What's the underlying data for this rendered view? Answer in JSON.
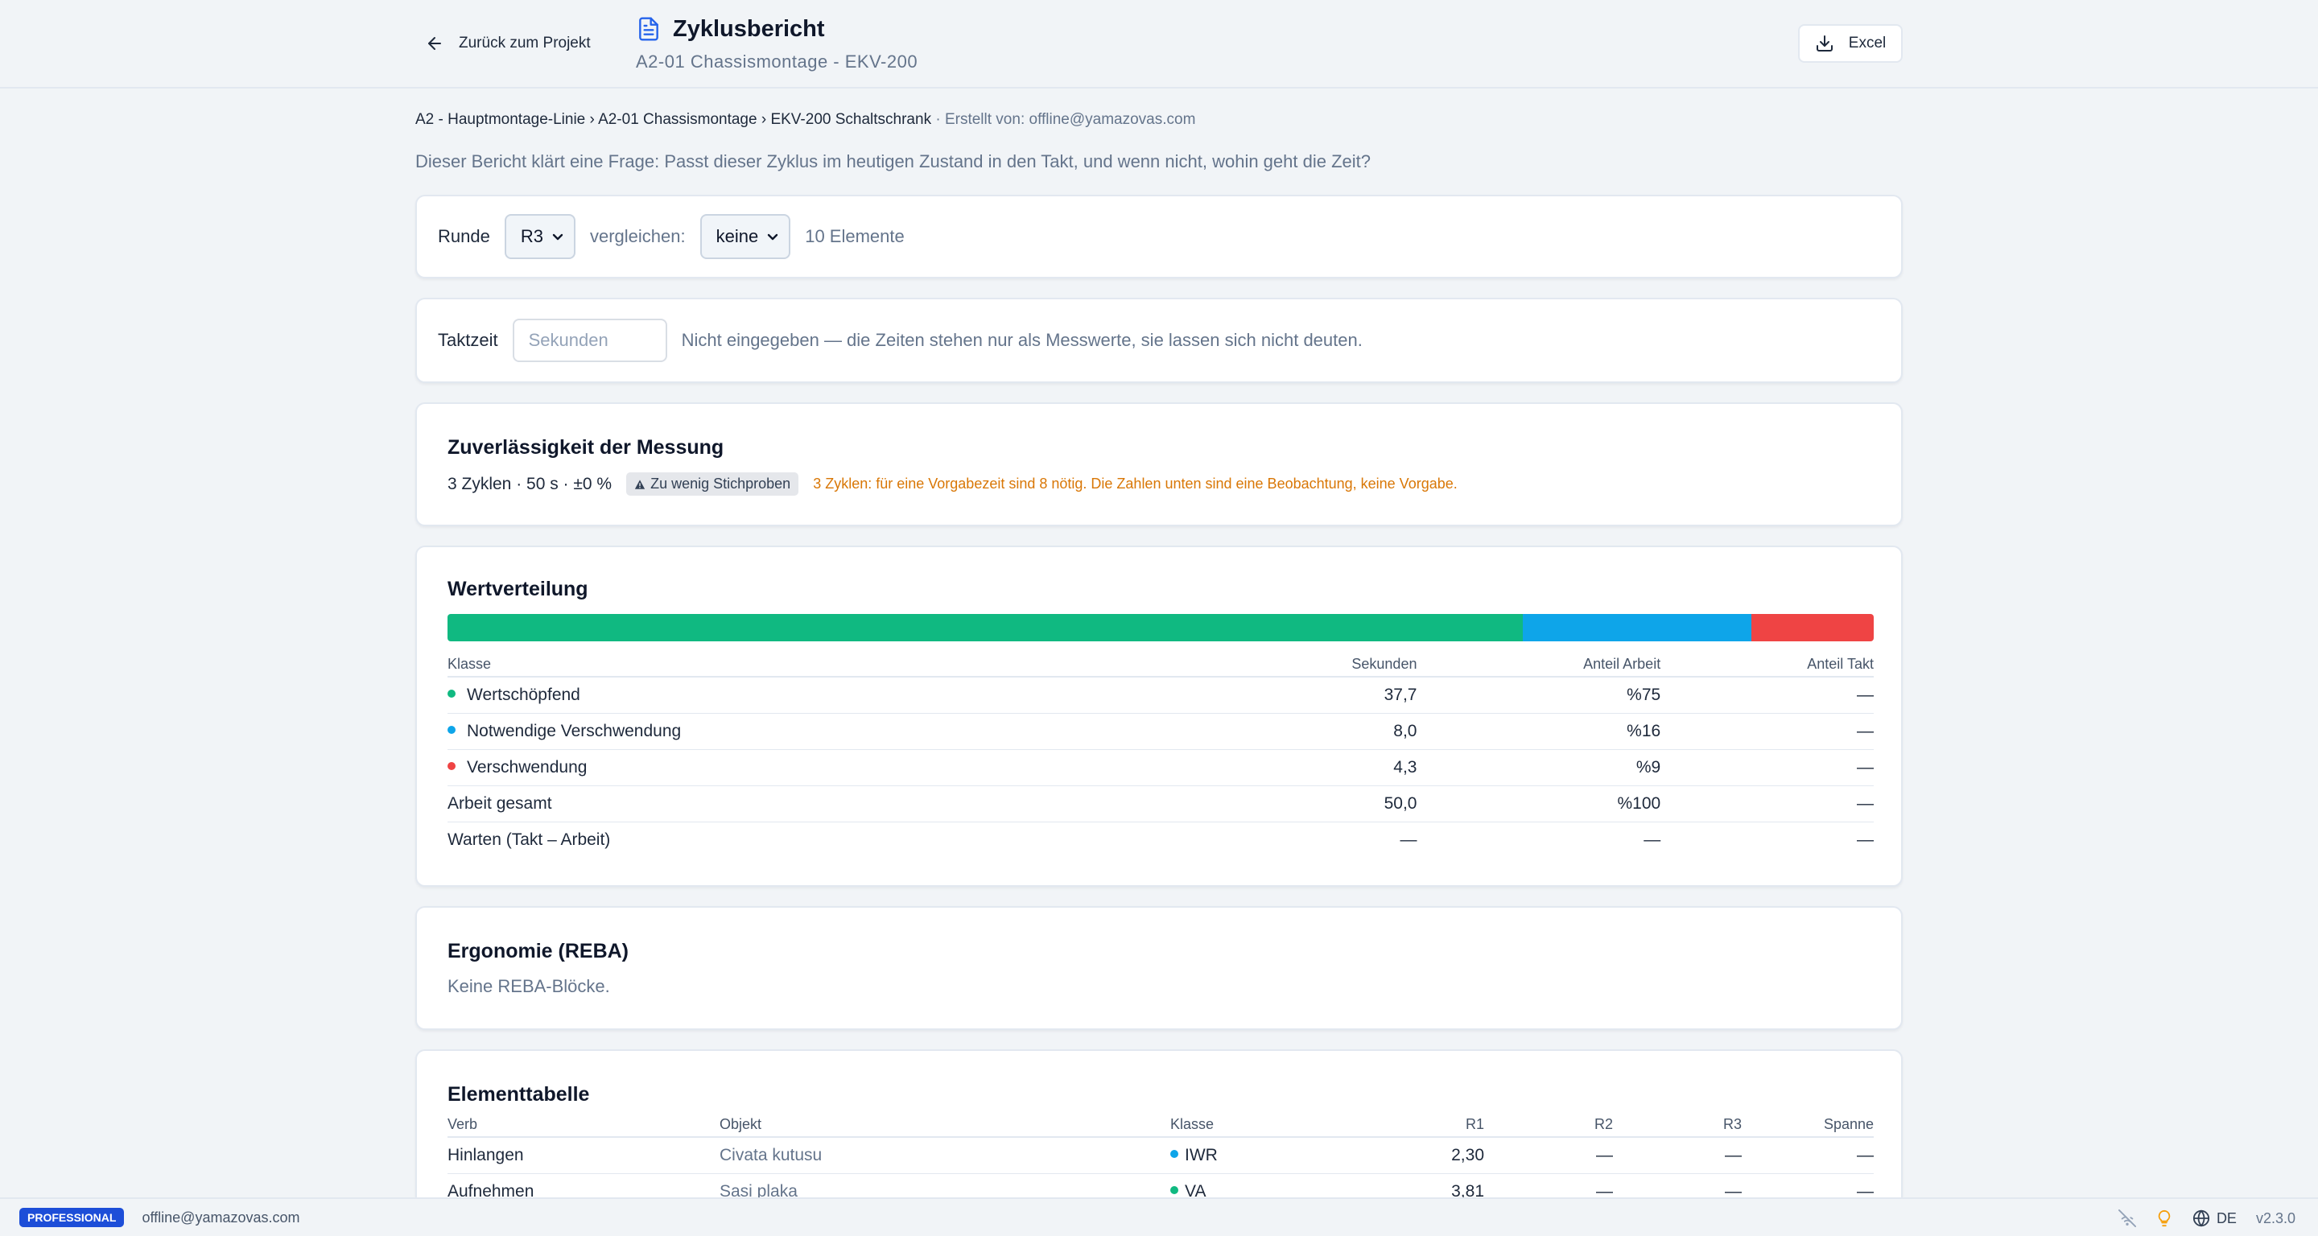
{
  "header": {
    "back_label": "Zurück zum Projekt",
    "title": "Zyklusbericht",
    "subtitle": "A2-01 Chassismontage - EKV-200",
    "excel_label": "Excel"
  },
  "breadcrumb": {
    "path": "A2 - Hauptmontage-Linie › A2-01 Chassismontage › EKV-200 Schaltschrank",
    "creator": " · Erstellt von: offline@yamazovas.com"
  },
  "intro": "Dieser Bericht klärt eine Frage: Passt dieser Zyklus im heutigen Zustand in den Takt, und wenn nicht, wohin geht die Zeit?",
  "round": {
    "label": "Runde",
    "selected": "R3",
    "compare_label": "vergleichen:",
    "compare_selected": "keine",
    "count": "10 Elemente"
  },
  "takt": {
    "label": "Taktzeit",
    "placeholder": "Sekunden",
    "note": "Nicht eingegeben — die Zeiten stehen nur als Messwerte, sie lassen sich nicht deuten."
  },
  "reliability": {
    "title": "Zuverlässigkeit der Messung",
    "summary": "3 Zyklen · 50 s · ±0 %",
    "badge": "Zu wenig Stichproben",
    "warning": "3 Zyklen: für eine Vorgabezeit sind 8 nötig. Die Zahlen unten sind eine Beobachtung, keine Vorgabe."
  },
  "distribution": {
    "title": "Wertverteilung",
    "bar": [
      {
        "share": 0.754,
        "color": "#10b981"
      },
      {
        "share": 0.16,
        "color": "#0ea5e9"
      },
      {
        "share": 0.086,
        "color": "#ef4444"
      }
    ],
    "columns": [
      "Klasse",
      "Sekunden",
      "Anteil Arbeit",
      "Anteil Takt"
    ],
    "rows": [
      {
        "label": "Wertschöpfend",
        "color": "#10b981",
        "seconds": "37,7",
        "work": "%75",
        "takt": "—"
      },
      {
        "label": "Notwendige Verschwendung",
        "color": "#0ea5e9",
        "seconds": "8,0",
        "work": "%16",
        "takt": "—"
      },
      {
        "label": "Verschwendung",
        "color": "#ef4444",
        "seconds": "4,3",
        "work": "%9",
        "takt": "—"
      },
      {
        "label": "Arbeit gesamt",
        "color": "",
        "seconds": "50,0",
        "work": "%100",
        "takt": "—"
      },
      {
        "label": "Warten (Takt – Arbeit)",
        "color": "",
        "seconds": "—",
        "work": "—",
        "takt": "—"
      }
    ]
  },
  "ergonomics": {
    "title": "Ergonomie (REBA)",
    "text": "Keine REBA-Blöcke."
  },
  "elements": {
    "title": "Elementtabelle",
    "columns": [
      "Verb",
      "Objekt",
      "Klasse",
      "R1",
      "R2",
      "R3",
      "Spanne"
    ],
    "rows": [
      {
        "verb": "Hinlangen",
        "object": "Civata kutusu",
        "class": "IWR",
        "color": "#0ea5e9",
        "r1": "2,30",
        "r2": "—",
        "r3": "—",
        "span": "—"
      },
      {
        "verb": "Aufnehmen",
        "object": "Sasi plaka",
        "class": "VA",
        "color": "#10b981",
        "r1": "3,81",
        "r2": "—",
        "r3": "—",
        "span": "—"
      }
    ]
  },
  "footer": {
    "plan": "PROFESSIONAL",
    "user": "offline@yamazovas.com",
    "lang": "DE",
    "version": "v2.3.0"
  }
}
